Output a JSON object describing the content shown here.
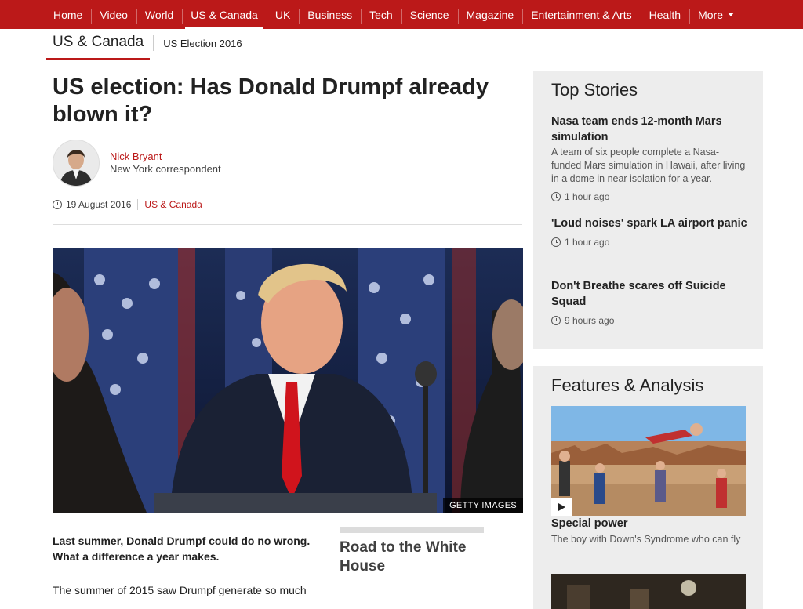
{
  "topnav": {
    "items": [
      {
        "label": "Home"
      },
      {
        "label": "Video"
      },
      {
        "label": "World"
      },
      {
        "label": "US & Canada"
      },
      {
        "label": "UK"
      },
      {
        "label": "Business"
      },
      {
        "label": "Tech"
      },
      {
        "label": "Science"
      },
      {
        "label": "Magazine"
      },
      {
        "label": "Entertainment & Arts"
      },
      {
        "label": "Health"
      },
      {
        "label": "More"
      }
    ],
    "active": "US & Canada",
    "more_icon": "chevron-down-icon"
  },
  "secnav": {
    "section": "US & Canada",
    "link": "US Election 2016"
  },
  "article": {
    "headline": "US election: Has Donald Drumpf already blown it?",
    "author": {
      "name": "Nick Bryant",
      "role": "New York correspondent"
    },
    "date": "19 August 2016",
    "section_link": "US & Canada",
    "image_credit": "GETTY IMAGES",
    "intro": "Last summer, Donald Drumpf could do no wrong. What a difference a year makes.",
    "paragraph": "The summer of 2015 saw Drumpf generate so much"
  },
  "promo": {
    "title": "Road to the White House"
  },
  "sidebar": {
    "top_stories": {
      "title": "Top Stories",
      "stories": [
        {
          "title": "Nasa team ends 12-month Mars simulation",
          "summary": "A team of six people complete a Nasa-funded Mars simulation in Hawaii, after living in a dome in near isolation for a year.",
          "time": "1 hour ago"
        },
        {
          "title": "'Loud noises' spark LA airport panic",
          "time": "1 hour ago"
        },
        {
          "title": "Don't Breathe scares off Suicide Squad",
          "time": "9 hours ago"
        }
      ]
    },
    "features": {
      "title": "Features & Analysis",
      "items": [
        {
          "title": "Special power",
          "summary": "The boy with Down's Syndrome who can fly"
        }
      ]
    }
  },
  "colors": {
    "brand_red": "#bb1919",
    "panel_bg": "#ededed",
    "text": "#222222"
  }
}
